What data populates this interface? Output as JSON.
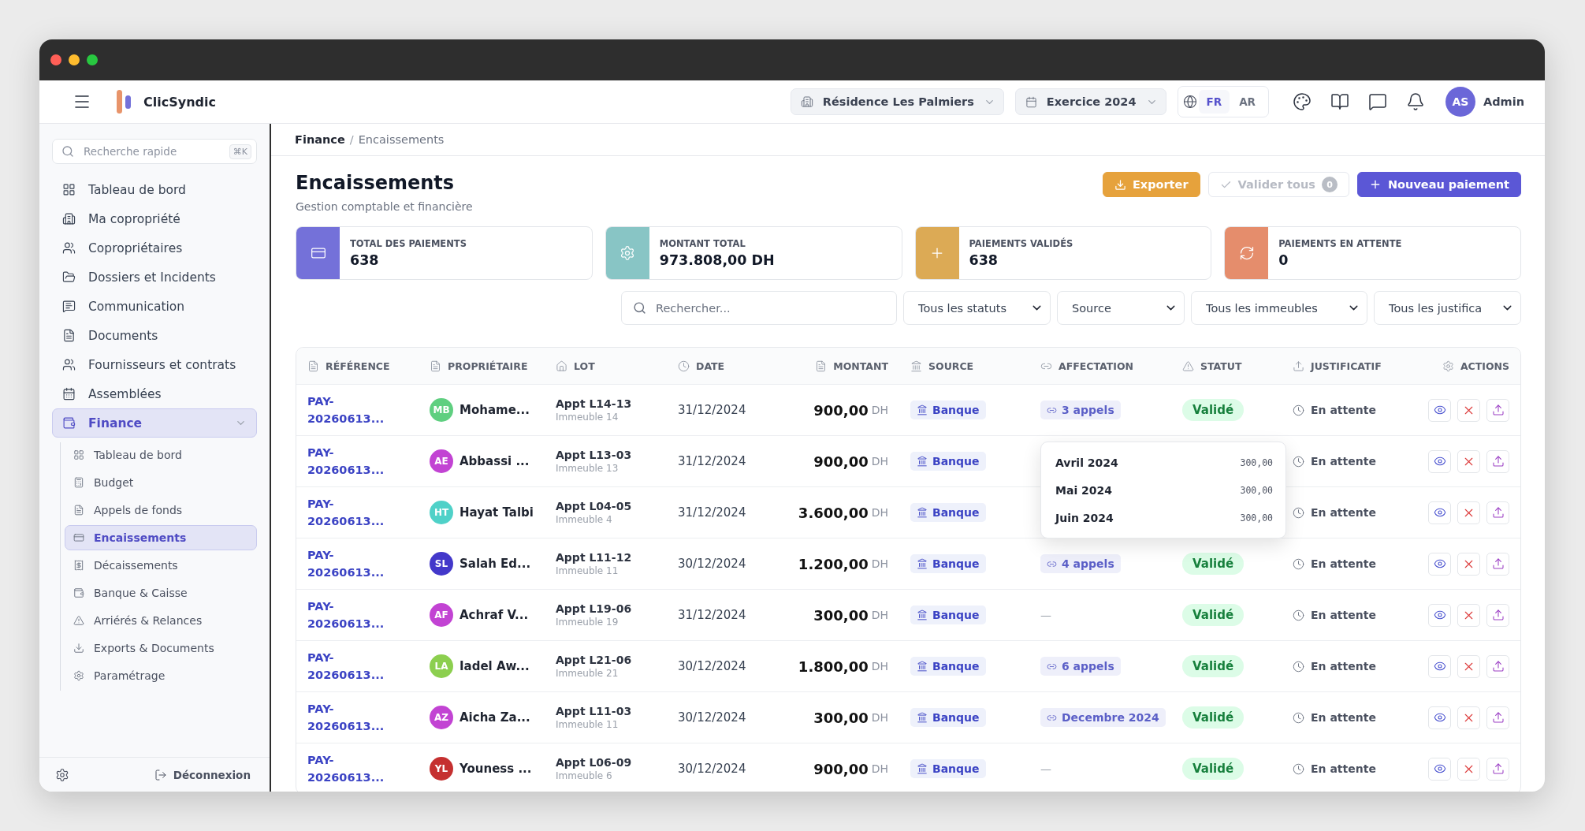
{
  "header": {
    "app_name": "ClicSyndic",
    "residence": "Résidence Les Palmiers",
    "exercise": "Exercice 2024",
    "languages": [
      {
        "label": "FR",
        "selected": true
      },
      {
        "label": "AR",
        "selected": false
      }
    ],
    "user": {
      "initials": "AS",
      "name": "Admin"
    }
  },
  "sidebar": {
    "search": {
      "placeholder": "Recherche rapide",
      "shortcut": "⌘K"
    },
    "items": [
      {
        "label": "Tableau de bord",
        "selected": false
      },
      {
        "label": "Ma copropriété",
        "selected": false
      },
      {
        "label": "Copropriétaires",
        "selected": false
      },
      {
        "label": "Dossiers et Incidents",
        "selected": false
      },
      {
        "label": "Communication",
        "selected": false
      },
      {
        "label": "Documents",
        "selected": false
      },
      {
        "label": "Fournisseurs et contrats",
        "selected": false
      },
      {
        "label": "Assemblées",
        "selected": false
      },
      {
        "label": "Finance",
        "selected": true,
        "expanded": true,
        "children": [
          {
            "label": "Tableau de bord",
            "selected": false
          },
          {
            "label": "Budget",
            "selected": false
          },
          {
            "label": "Appels de fonds",
            "selected": false
          },
          {
            "label": "Encaissements",
            "selected": true
          },
          {
            "label": "Décaissements",
            "selected": false
          },
          {
            "label": "Banque & Caisse",
            "selected": false
          },
          {
            "label": "Arriérés & Relances",
            "selected": false
          },
          {
            "label": "Exports & Documents",
            "selected": false
          },
          {
            "label": "Paramétrage",
            "selected": false
          }
        ]
      }
    ],
    "logout": "Déconnexion"
  },
  "breadcrumb": {
    "items": [
      "Finance",
      "Encaissements"
    ],
    "separator": "/"
  },
  "page": {
    "title": "Encaissements",
    "subtitle": "Gestion comptable et financière",
    "export": "Exporter",
    "validate": {
      "label": "Valider tous",
      "count": "0",
      "disabled": true
    },
    "new": "Nouveau paiement"
  },
  "stats": [
    {
      "label": "TOTAL DES PAIEMENTS",
      "value": "638",
      "color": "#7471d9"
    },
    {
      "label": "MONTANT TOTAL",
      "value": "973.808,00 DH",
      "color": "#88c5c5"
    },
    {
      "label": "PAIEMENTS VALIDÉS",
      "value": "638",
      "color": "#dcaa55"
    },
    {
      "label": "PAIEMENTS EN ATTENTE",
      "value": "0",
      "color": "#e58d6c"
    }
  ],
  "filters": {
    "search": {
      "placeholder": "Rechercher..."
    },
    "selects": [
      "Tous les statuts",
      "Source",
      "Tous les immeubles",
      "Tous les justifica"
    ]
  },
  "table": {
    "columns": [
      "RÉFÉRENCE",
      "PROPRIÉTAIRE",
      "LOT",
      "DATE",
      "MONTANT",
      "SOURCE",
      "AFFECTATION",
      "STATUT",
      "JUSTIFICATIF",
      "ACTIONS"
    ],
    "rows": [
      {
        "reference": "PAY-20260613...",
        "owner": {
          "initials": "MB",
          "name": "Mohame...",
          "color": "#5fcf80"
        },
        "lot": "Appt L14-13",
        "building": "Immeuble 14",
        "date": "31/12/2024",
        "amount": "900,00",
        "currency": "DH",
        "source": "Banque",
        "affectation": {
          "kind": "link",
          "text": "3 appels",
          "popover": [
            {
              "label": "Avril 2024",
              "amount": "300,00"
            },
            {
              "label": "Mai 2024",
              "amount": "300,00"
            },
            {
              "label": "Juin 2024",
              "amount": "300,00"
            }
          ]
        },
        "status": "Validé",
        "proof": "En attente"
      },
      {
        "reference": "PAY-20260613...",
        "owner": {
          "initials": "AE",
          "name": "Abbassi ...",
          "color": "#c243d3"
        },
        "lot": "Appt L13-03",
        "building": "Immeuble 13",
        "date": "31/12/2024",
        "amount": "900,00",
        "currency": "DH",
        "source": "Banque",
        "proof": "En attente"
      },
      {
        "reference": "PAY-20260613...",
        "owner": {
          "initials": "HT",
          "name": "Hayat Talbi",
          "color": "#4fd1c8"
        },
        "lot": "Appt L04-05",
        "building": "Immeuble 4",
        "date": "31/12/2024",
        "amount": "3.600,00",
        "currency": "DH",
        "source": "Banque",
        "proof": "En attente"
      },
      {
        "reference": "PAY-20260613...",
        "owner": {
          "initials": "SL",
          "name": "Salah Ed...",
          "color": "#4338ca"
        },
        "lot": "Appt L11-12",
        "building": "Immeuble 11",
        "date": "30/12/2024",
        "amount": "1.200,00",
        "currency": "DH",
        "source": "Banque",
        "affectation": {
          "kind": "link",
          "text": "4 appels"
        },
        "status": "Validé",
        "proof": "En attente"
      },
      {
        "reference": "PAY-20260613...",
        "owner": {
          "initials": "AF",
          "name": "Achraf V...",
          "color": "#c243d3"
        },
        "lot": "Appt L19-06",
        "building": "Immeuble 19",
        "date": "31/12/2024",
        "amount": "300,00",
        "currency": "DH",
        "source": "Banque",
        "affectation": {
          "kind": "empty",
          "text": "—"
        },
        "status": "Validé",
        "proof": "En attente"
      },
      {
        "reference": "PAY-20260613...",
        "owner": {
          "initials": "LA",
          "name": "Iadel Aw...",
          "color": "#8ccf4f"
        },
        "lot": "Appt L21-06",
        "building": "Immeuble 21",
        "date": "30/12/2024",
        "amount": "1.800,00",
        "currency": "DH",
        "source": "Banque",
        "affectation": {
          "kind": "link",
          "text": "6 appels"
        },
        "status": "Validé",
        "proof": "En attente"
      },
      {
        "reference": "PAY-20260613...",
        "owner": {
          "initials": "AZ",
          "name": "Aicha Za...",
          "color": "#c243d3"
        },
        "lot": "Appt L11-03",
        "building": "Immeuble 11",
        "date": "30/12/2024",
        "amount": "300,00",
        "currency": "DH",
        "source": "Banque",
        "affectation": {
          "kind": "link",
          "text": "Decembre 2024"
        },
        "status": "Validé",
        "proof": "En attente"
      },
      {
        "reference": "PAY-20260613...",
        "owner": {
          "initials": "YL",
          "name": "Youness ...",
          "color": "#c53030"
        },
        "lot": "Appt L06-09",
        "building": "Immeuble 6",
        "date": "30/12/2024",
        "amount": "900,00",
        "currency": "DH",
        "source": "Banque",
        "affectation": {
          "kind": "empty",
          "text": "—"
        },
        "status": "Validé",
        "proof": "En attente"
      }
    ]
  }
}
